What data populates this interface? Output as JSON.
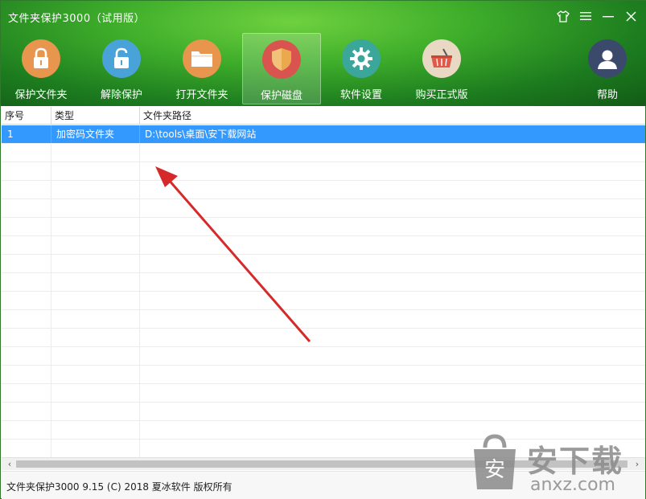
{
  "window": {
    "title": "文件夹保护3000（试用版）"
  },
  "toolbar": {
    "items": [
      {
        "label": "保护文件夹",
        "icon": "lock-closed-icon",
        "color": "#e8954d"
      },
      {
        "label": "解除保护",
        "icon": "lock-open-icon",
        "color": "#4aa3d8"
      },
      {
        "label": "打开文件夹",
        "icon": "folder-icon",
        "color": "#e8954d"
      },
      {
        "label": "保护磁盘",
        "icon": "shield-icon",
        "color": "#d9534f",
        "active": true
      },
      {
        "label": "软件设置",
        "icon": "gear-icon",
        "color": "#3aa79a"
      },
      {
        "label": "购买正式版",
        "icon": "basket-icon",
        "color": "#e9d9c4"
      },
      {
        "label": "帮助",
        "icon": "user-icon",
        "color": "#3b4a6b"
      }
    ]
  },
  "table": {
    "columns": [
      "序号",
      "类型",
      "文件夹路径"
    ],
    "rows": [
      {
        "index": "1",
        "type": "加密码文件夹",
        "path": "D:\\tools\\桌面\\安下载网站",
        "selected": true
      }
    ]
  },
  "status": {
    "text": "文件夹保护3000 9.15 (C) 2018 夏冰软件 版权所有"
  },
  "scrollbar": {
    "left_arrow": "‹",
    "right_arrow": "›"
  },
  "watermark": {
    "cn": "安下载",
    "en": "anxz.com",
    "badge": "安"
  },
  "colors": {
    "header_green": "#3fae2b",
    "selection_blue": "#3399ff",
    "annotation_red": "#d62a2a"
  }
}
